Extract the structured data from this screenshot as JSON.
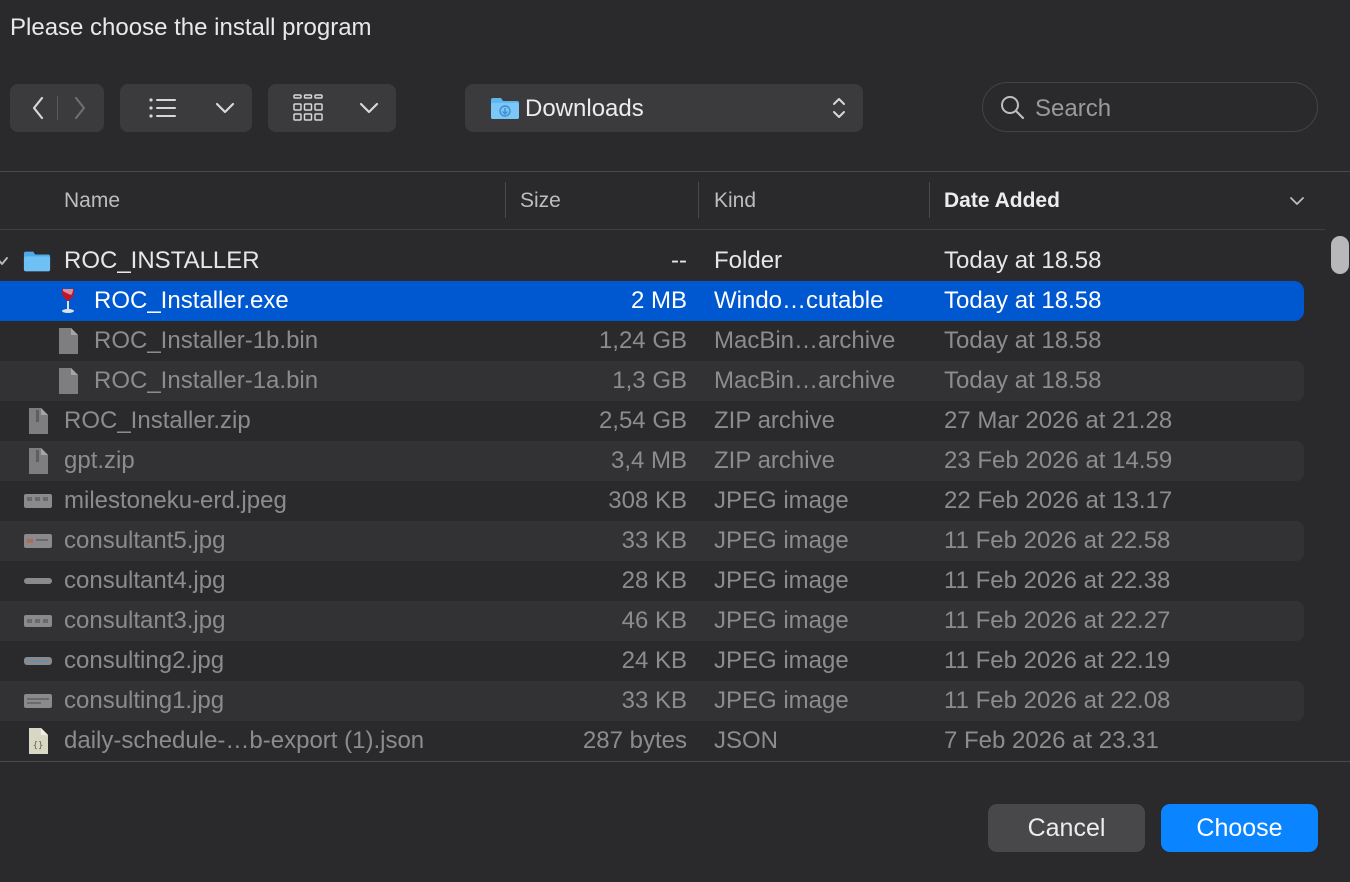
{
  "dialog": {
    "title": "Please choose the install program"
  },
  "toolbar": {
    "location": "Downloads",
    "search_placeholder": "Search"
  },
  "columns": {
    "name": "Name",
    "size": "Size",
    "kind": "Kind",
    "date_added": "Date Added"
  },
  "rows": [
    {
      "name": "ROC_INSTALLER",
      "size": "--",
      "kind": "Folder",
      "date": "Today at 18.58",
      "icon": "folder-icon"
    },
    {
      "name": "ROC_Installer.exe",
      "size": "2 MB",
      "kind": "Windo…cutable",
      "date": "Today at 18.58",
      "icon": "wine-icon"
    },
    {
      "name": "ROC_Installer-1b.bin",
      "size": "1,24 GB",
      "kind": "MacBin…archive",
      "date": "Today at 18.58",
      "icon": "document-icon"
    },
    {
      "name": "ROC_Installer-1a.bin",
      "size": "1,3 GB",
      "kind": "MacBin…archive",
      "date": "Today at 18.58",
      "icon": "document-icon"
    },
    {
      "name": "ROC_Installer.zip",
      "size": "2,54 GB",
      "kind": "ZIP archive",
      "date": "27 Mar 2026 at 21.28",
      "icon": "zip-icon"
    },
    {
      "name": "gpt.zip",
      "size": "3,4 MB",
      "kind": "ZIP archive",
      "date": "23 Feb 2026 at 14.59",
      "icon": "zip-icon"
    },
    {
      "name": "milestoneku-erd.jpeg",
      "size": "308 KB",
      "kind": "JPEG image",
      "date": "22 Feb 2026 at 13.17",
      "icon": "image-thumbnail-icon"
    },
    {
      "name": "consultant5.jpg",
      "size": "33 KB",
      "kind": "JPEG image",
      "date": "11 Feb 2026 at 22.58",
      "icon": "image-thumbnail-icon"
    },
    {
      "name": "consultant4.jpg",
      "size": "28 KB",
      "kind": "JPEG image",
      "date": "11 Feb 2026 at 22.38",
      "icon": "image-thumbnail-icon"
    },
    {
      "name": "consultant3.jpg",
      "size": "46 KB",
      "kind": "JPEG image",
      "date": "11 Feb 2026 at 22.27",
      "icon": "image-thumbnail-icon"
    },
    {
      "name": "consulting2.jpg",
      "size": "24 KB",
      "kind": "JPEG image",
      "date": "11 Feb 2026 at 22.19",
      "icon": "image-thumbnail-icon"
    },
    {
      "name": "consulting1.jpg",
      "size": "33 KB",
      "kind": "JPEG image",
      "date": "11 Feb 2026 at 22.08",
      "icon": "image-thumbnail-icon"
    },
    {
      "name": "daily-schedule-…b-export (1).json",
      "size": "287 bytes",
      "kind": "JSON",
      "date": "7 Feb 2026 at 23.31",
      "icon": "json-file-icon"
    }
  ],
  "buttons": {
    "cancel": "Cancel",
    "choose": "Choose"
  },
  "colors": {
    "selection": "#0058d0",
    "primary_button": "#0a84ff",
    "background": "#2a2a2c"
  }
}
